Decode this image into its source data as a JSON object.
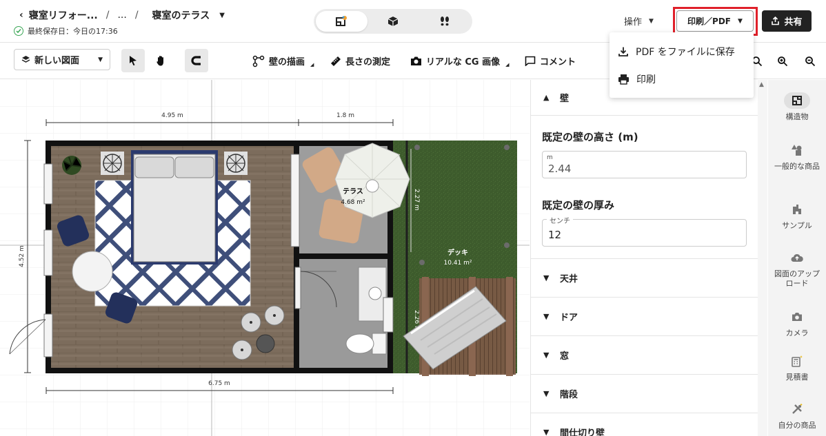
{
  "header": {
    "breadcrumb_parent": "寝室リフォー...",
    "breadcrumb_ellipsis": "...",
    "breadcrumb_current": "寝室のテラス",
    "saved_status": "最終保存日：今日の17:36",
    "operations_label": "操作",
    "print_label": "印刷／PDF",
    "share_label": "共有"
  },
  "print_menu": {
    "items": [
      {
        "label": "PDF をファイルに保存",
        "icon": "download-icon"
      },
      {
        "label": "印刷",
        "icon": "printer-icon"
      }
    ]
  },
  "toolbar": {
    "new_plan_label": "新しい図面",
    "draw_walls": "壁の描画",
    "measure": "長さの測定",
    "realistic_cg": "リアルな CG 画像",
    "comment": "コメント"
  },
  "plan": {
    "dim_top_left": "4.95 m",
    "dim_top_right": "1.8 m",
    "dim_left": "4.52 m",
    "dim_bottom": "6.75 m",
    "dim_terrace_right": "2.27 m",
    "dim_bath_right": "2.26 m",
    "terrace_name": "テラス",
    "terrace_area": "4.68 m²",
    "deck_name": "デッキ",
    "deck_area": "10.41 m²",
    "colors": {
      "wall": "#1a1a1a",
      "floor": "#7a6a5a",
      "grass": "#3b5a2a",
      "tile": "#9a9a9a"
    }
  },
  "panel": {
    "walls_heading": "壁",
    "wall_height_label": "既定の壁の高さ (m)",
    "wall_height_unit": "m",
    "wall_height_value": "2.44",
    "wall_thickness_label": "既定の壁の厚み",
    "wall_thickness_unit": "センチ",
    "wall_thickness_value": "12",
    "sections": [
      "天井",
      "ドア",
      "窓",
      "階段",
      "間仕切り壁"
    ]
  },
  "sidebar": {
    "items": [
      {
        "label": "構造物",
        "icon": "structure-icon"
      },
      {
        "label": "一般的な商品",
        "icon": "shapes-icon"
      },
      {
        "label": "サンプル",
        "icon": "house-icon"
      },
      {
        "label": "図面のアップロード",
        "icon": "upload-cloud-icon"
      },
      {
        "label": "カメラ",
        "icon": "camera-icon"
      },
      {
        "label": "見積書",
        "icon": "calculator-icon"
      },
      {
        "label": "自分の商品",
        "icon": "tools-icon"
      }
    ]
  }
}
